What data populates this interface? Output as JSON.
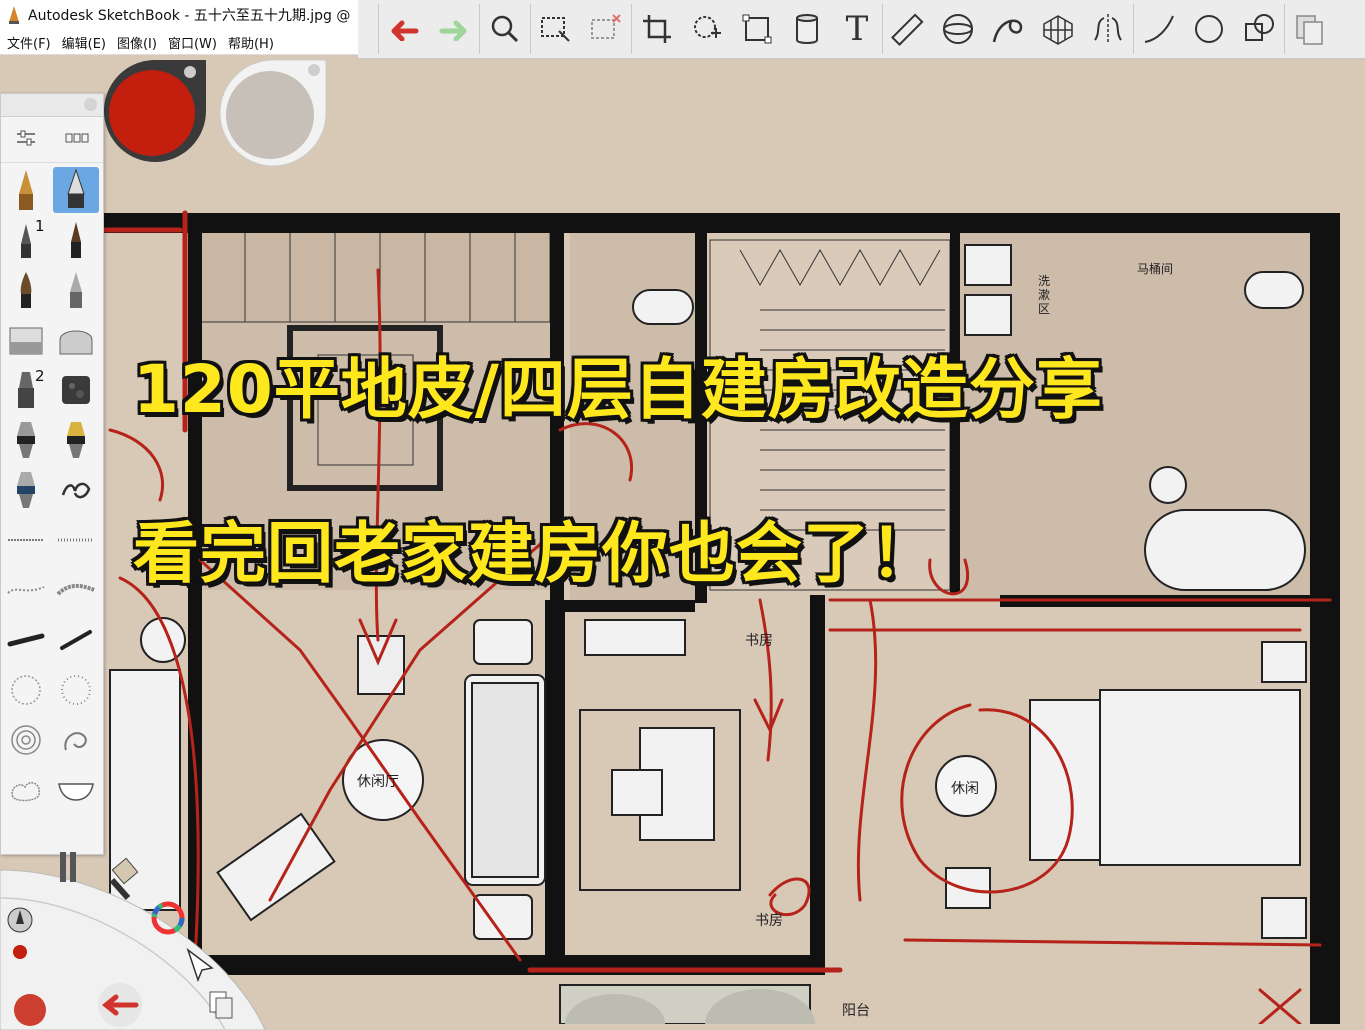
{
  "window": {
    "title": "Autodesk SketchBook - 五十六至五十九期.jpg @"
  },
  "menubar": {
    "items": [
      "文件(F)",
      "编辑(E)",
      "图像(I)",
      "窗口(W)",
      "帮助(H)"
    ]
  },
  "toolbar": {
    "tools": [
      "undo-icon",
      "redo-icon",
      "zoom-icon",
      "select-icon",
      "select-clear-icon",
      "crop-icon",
      "lasso-transform-icon",
      "distort-icon",
      "fill-bucket-icon",
      "text-icon",
      "ruler-icon",
      "ellipse-guide-icon",
      "curve-guide-icon",
      "perspective-icon",
      "symmetry-icon",
      "stroke-tool-icon",
      "shape-tool-icon",
      "copy-icon"
    ],
    "text_tool_glyph": "T"
  },
  "colors": {
    "primary": "#c41e0e",
    "secondary": "#c6c0b8",
    "accent_selected": "#6ba7e3",
    "overlay_text": "#ffe71e",
    "canvas_bg": "#d8c8b6"
  },
  "brush_palette": {
    "brushes": [
      "pencil-icon",
      "inking-pen-icon",
      "ballpoint-icon",
      "brush-pen-icon",
      "paint-brush-icon",
      "hard-pencil-icon",
      "eraser-hard-icon",
      "eraser-soft-icon",
      "marker-icon",
      "texture-brush-icon",
      "airbrush-icon",
      "airbrush-gold-icon",
      "airbrush-small-icon",
      "smudge-icon",
      "texture-line-icon",
      "texture-line-2-icon",
      "foliage-icon",
      "foliage-2-icon",
      "splatter-icon",
      "splatter-2-icon",
      "scatter-icon",
      "scatter-2-icon",
      "swirl-icon",
      "swirl-2-icon",
      "cloud-icon",
      "bowl-icon"
    ],
    "selected_index": 1,
    "slot_numbers": [
      "1",
      "2"
    ]
  },
  "overlay": {
    "line1": "120平地皮/四层自建房改造分享",
    "line2": "看完回老家建房你也会了！"
  },
  "floorplan_labels": {
    "toilet_room": "马桶间",
    "wash_area": "洗漱区",
    "lounge_hall": "休闲厅",
    "study": "书房",
    "study_2": "书房",
    "leisure": "休闲",
    "balcony": "阳台"
  }
}
